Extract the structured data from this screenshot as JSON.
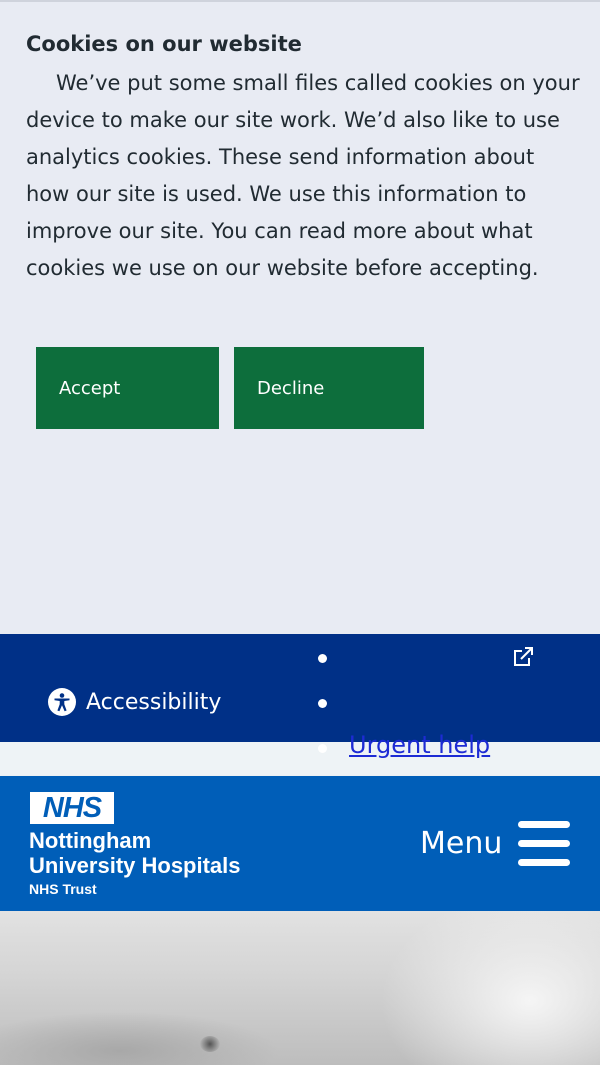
{
  "cookie_banner": {
    "title": "Cookies on our website",
    "text": "We’ve put some small files called cookies on your device to make our site work. We’d also like to use analytics cookies. These send information about how our site is used. We use this information to improve our site. You can read more about what cookies we use on our website before accepting.",
    "accept_label": "Accept",
    "decline_label": "Decline"
  },
  "utility_bar": {
    "accessibility_label": "Accessibility",
    "urgent_help_label": "Urgent help"
  },
  "header": {
    "logo_text": "NHS",
    "org_name_line1": "Nottingham",
    "org_name_line2": "University Hospitals",
    "org_sub": "NHS Trust",
    "menu_label": "Menu"
  },
  "icons": {
    "accessibility": "accessibility-icon",
    "external_link": "external-link-icon",
    "menu": "hamburger-menu-icon"
  },
  "colors": {
    "banner_bg": "#e8ebf3",
    "button_green": "#0d6e3c",
    "utility_navy": "#003087",
    "nhs_blue": "#005eb8",
    "link_blue": "#1d2bd4"
  }
}
